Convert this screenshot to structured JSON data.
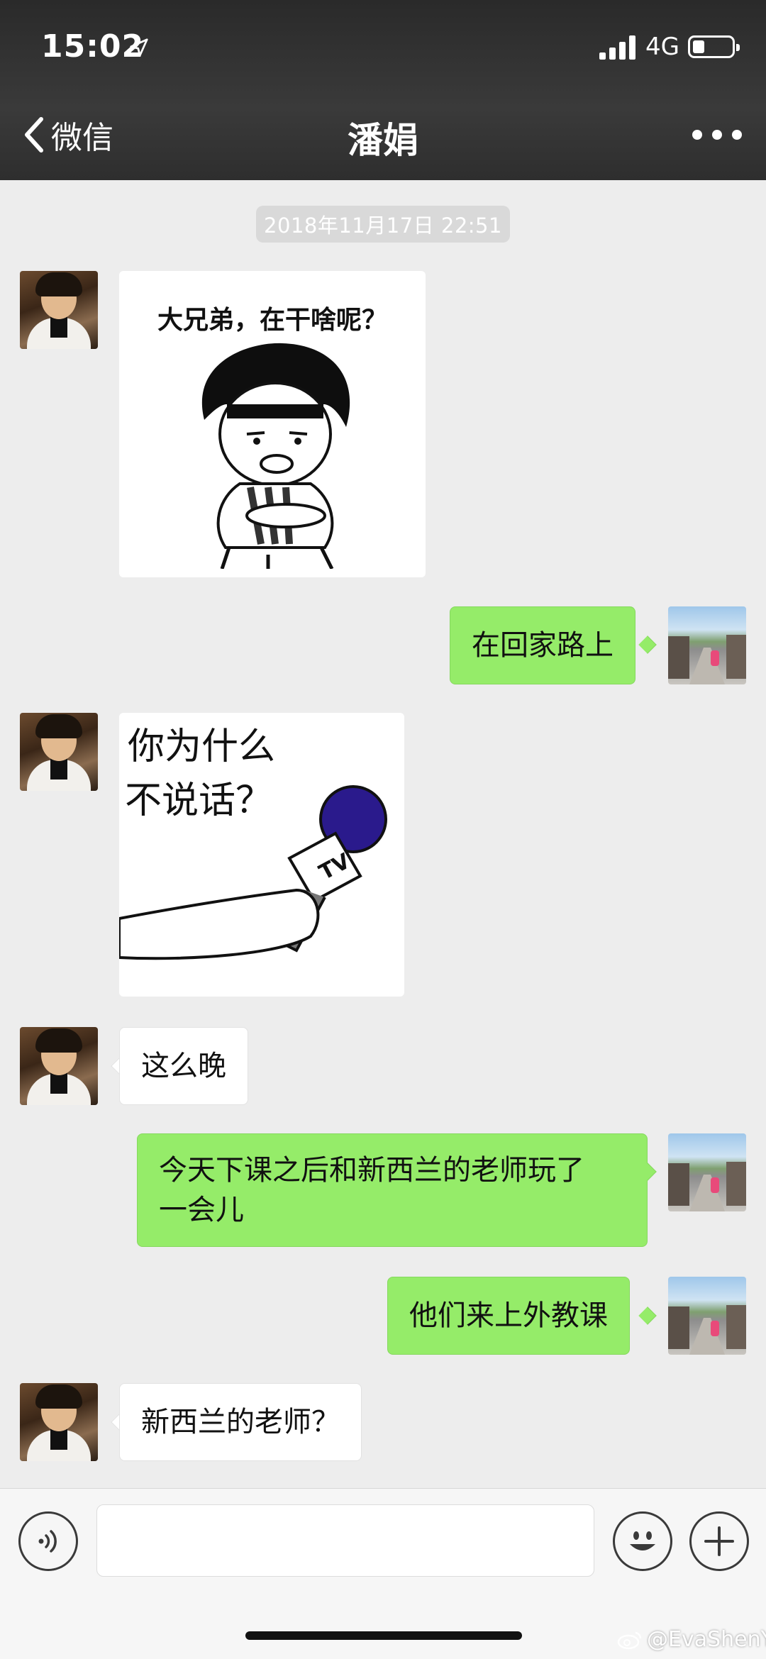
{
  "status_bar": {
    "time": "15:02",
    "network": "4G"
  },
  "nav": {
    "back_label": "微信",
    "title": "潘娟"
  },
  "chat": {
    "timestamp": "2018年11月17日 22:51",
    "sticker1_text": "大兄弟，在干啥呢？",
    "msg1": "在回家路上",
    "sticker2_line1": "你为什么",
    "sticker2_line2": "不说话？",
    "sticker2_mic": "TV",
    "msg2": "这么晚",
    "msg3_line1": "今天下课之后和新西兰的老师玩了",
    "msg3_line2": "一会儿",
    "msg4": "他们来上外教课",
    "msg5": "新西兰的老师？"
  },
  "watermark": "@EvaShenY",
  "icons": [
    "back-chevron-icon",
    "more-icon",
    "voice-icon",
    "emoji-icon",
    "plus-icon",
    "location-arrow-icon",
    "signal-icon",
    "battery-icon",
    "weibo-icon"
  ]
}
